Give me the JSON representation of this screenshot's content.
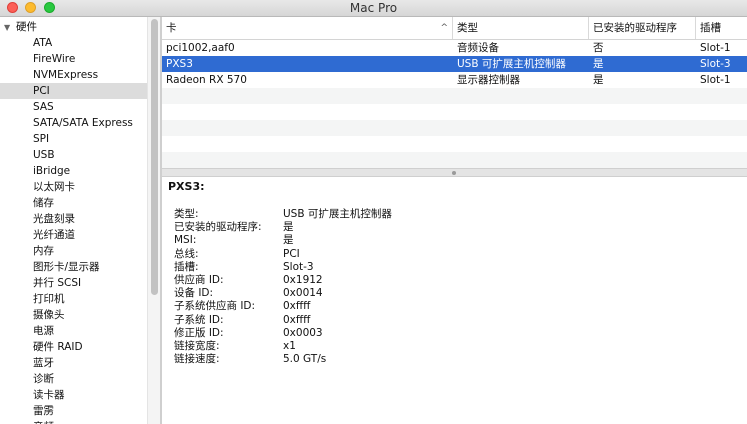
{
  "window": {
    "title": "Mac Pro"
  },
  "sidebar": {
    "items": [
      {
        "label": "硬件",
        "level": 0,
        "expanded": true
      },
      {
        "label": "ATA",
        "level": 1
      },
      {
        "label": "FireWire",
        "level": 1
      },
      {
        "label": "NVMExpress",
        "level": 1
      },
      {
        "label": "PCI",
        "level": 1,
        "selected": true
      },
      {
        "label": "SAS",
        "level": 1
      },
      {
        "label": "SATA/SATA Express",
        "level": 1
      },
      {
        "label": "SPI",
        "level": 1
      },
      {
        "label": "USB",
        "level": 1
      },
      {
        "label": "iBridge",
        "level": 1
      },
      {
        "label": "以太网卡",
        "level": 1
      },
      {
        "label": "储存",
        "level": 1
      },
      {
        "label": "光盘刻录",
        "level": 1
      },
      {
        "label": "光纤通道",
        "level": 1
      },
      {
        "label": "内存",
        "level": 1
      },
      {
        "label": "图形卡/显示器",
        "level": 1
      },
      {
        "label": "并行 SCSI",
        "level": 1
      },
      {
        "label": "打印机",
        "level": 1
      },
      {
        "label": "摄像头",
        "level": 1
      },
      {
        "label": "电源",
        "level": 1
      },
      {
        "label": "硬件 RAID",
        "level": 1
      },
      {
        "label": "蓝牙",
        "level": 1
      },
      {
        "label": "诊断",
        "level": 1
      },
      {
        "label": "读卡器",
        "level": 1
      },
      {
        "label": "雷雳",
        "level": 1
      },
      {
        "label": "音频",
        "level": 1
      }
    ]
  },
  "table": {
    "columns": [
      "卡",
      "类型",
      "已安装的驱动程序",
      "插槽"
    ],
    "rows": [
      [
        "pci1002,aaf0",
        "音频设备",
        "否",
        "Slot-1"
      ],
      [
        "PXS3",
        "USB 可扩展主机控制器",
        "是",
        "Slot-3"
      ],
      [
        "Radeon RX 570",
        "显示器控制器",
        "是",
        "Slot-1"
      ]
    ],
    "selected_row": 1
  },
  "detail": {
    "title": "PXS3:",
    "properties": [
      {
        "key": "类型:",
        "value": "USB 可扩展主机控制器"
      },
      {
        "key": "已安装的驱动程序:",
        "value": "是"
      },
      {
        "key": "MSI:",
        "value": "是"
      },
      {
        "key": "总线:",
        "value": "PCI"
      },
      {
        "key": "插槽:",
        "value": "Slot-3"
      },
      {
        "key": "供应商 ID:",
        "value": "0x1912"
      },
      {
        "key": "设备 ID:",
        "value": "0x0014"
      },
      {
        "key": "子系统供应商 ID:",
        "value": "0xffff"
      },
      {
        "key": "子系统 ID:",
        "value": "0xffff"
      },
      {
        "key": "修正版 ID:",
        "value": "0x0003"
      },
      {
        "key": "链接宽度:",
        "value": "x1"
      },
      {
        "key": "链接速度:",
        "value": "5.0 GT/s"
      }
    ]
  },
  "colors": {
    "selection": "#2f6bd2",
    "sidebar_selection": "#dcdcdc"
  }
}
